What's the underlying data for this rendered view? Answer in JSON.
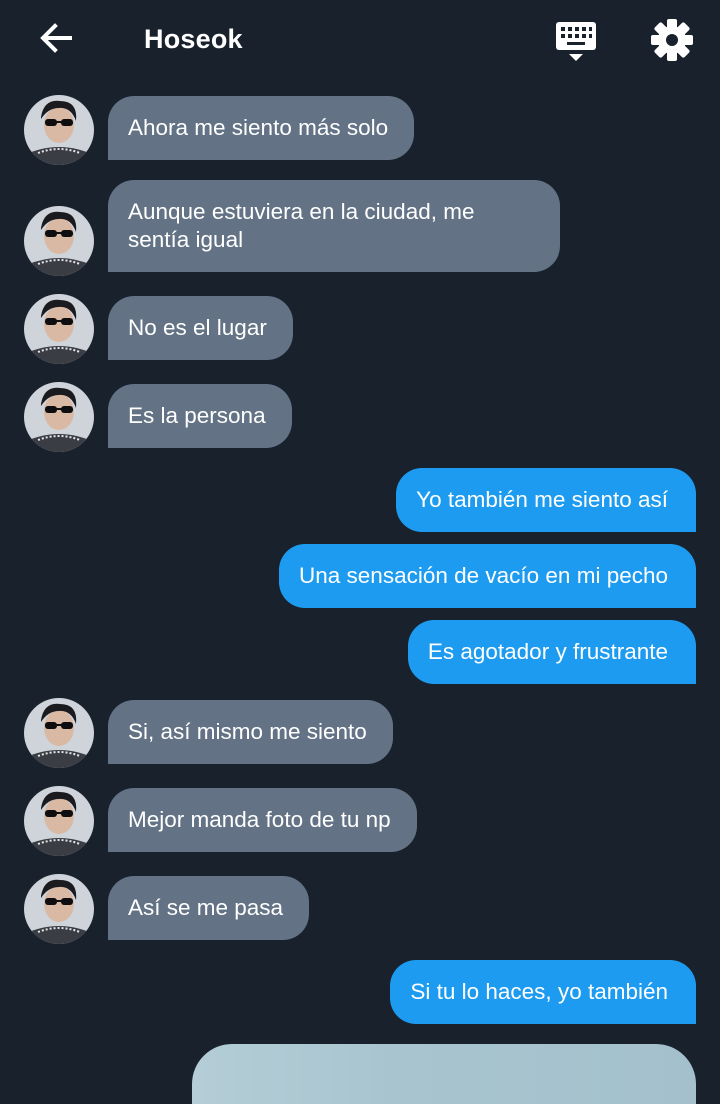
{
  "header": {
    "title": "Hoseok",
    "back_icon": "arrow-left-icon",
    "keyboard_icon": "keyboard-icon",
    "settings_icon": "gear-icon"
  },
  "colors": {
    "background": "#19212d",
    "incoming_bubble": "#637385",
    "outgoing_bubble": "#1d9bf0"
  },
  "messages": [
    {
      "side": "in",
      "text": "Ahora me siento más solo"
    },
    {
      "side": "in",
      "text": "Aunque estuviera en la ciudad, me sentía igual"
    },
    {
      "side": "in",
      "text": "No es el lugar"
    },
    {
      "side": "in",
      "text": "Es la persona"
    },
    {
      "side": "out",
      "text": "Yo también me siento así"
    },
    {
      "side": "out",
      "text": "Una sensación de vacío en mi pecho"
    },
    {
      "side": "out",
      "text": "Es agotador y frustrante"
    },
    {
      "side": "in",
      "text": "Si, así mismo me siento"
    },
    {
      "side": "in",
      "text": "Mejor manda foto de tu np"
    },
    {
      "side": "in",
      "text": "Así se me pasa"
    },
    {
      "side": "out",
      "text": "Si tu lo haces, yo también"
    }
  ]
}
